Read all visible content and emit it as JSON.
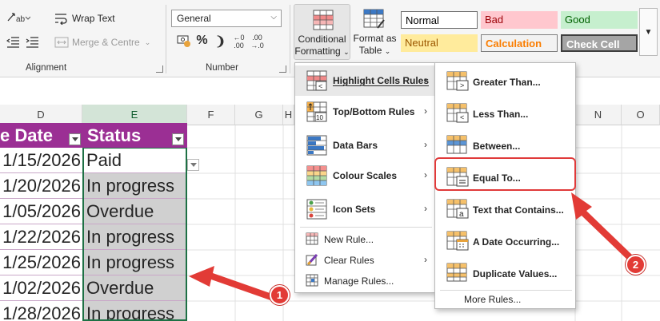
{
  "ribbon": {
    "alignment": {
      "wrap_text": "Wrap Text",
      "merge_centre": "Merge & Centre",
      "group_label": "Alignment"
    },
    "number": {
      "format_value": "General",
      "group_label": "Number",
      "icons": [
        "accounting-format-icon",
        "percent-icon",
        "comma-style-icon",
        "increase-decimal-icon",
        "decrease-decimal-icon"
      ]
    },
    "conditional_formatting": {
      "line1": "Conditional",
      "line2": "Formatting"
    },
    "format_as_table": {
      "line1": "Format as",
      "line2": "Table"
    },
    "cell_styles": [
      {
        "label": "Normal",
        "bg": "#ffffff",
        "fg": "#000000"
      },
      {
        "label": "Bad",
        "bg": "#ffc7ce",
        "fg": "#9c0006"
      },
      {
        "label": "Good",
        "bg": "#c6efce",
        "fg": "#006100"
      },
      {
        "label": "Neutral",
        "bg": "#ffeb9c",
        "fg": "#9c5700"
      },
      {
        "label": "Calculation",
        "bg": "#f2f2f2",
        "fg": "#fa7d00"
      },
      {
        "label": "Check Cell",
        "bg": "#a5a5a5",
        "fg": "#ffffff"
      }
    ]
  },
  "sheet": {
    "columns": [
      "D",
      "E",
      "F",
      "G",
      "H",
      "N",
      "O"
    ],
    "table_headers": {
      "due_date": "e Date",
      "status": "Status"
    },
    "rows": [
      {
        "date": "1/15/2026",
        "status": "Paid"
      },
      {
        "date": "1/20/2026",
        "status": "In progress"
      },
      {
        "date": "1/05/2026",
        "status": "Overdue"
      },
      {
        "date": "1/22/2026",
        "status": "In progress"
      },
      {
        "date": "1/25/2026",
        "status": "In progress"
      },
      {
        "date": "1/02/2026",
        "status": "Overdue"
      },
      {
        "date": "1/28/2026",
        "status": "In progress"
      }
    ]
  },
  "cf_menu": {
    "items": [
      {
        "label": "Highlight Cells Rules",
        "icon": "highlight-cells-icon"
      },
      {
        "label": "Top/Bottom Rules",
        "icon": "top-bottom-icon"
      },
      {
        "label": "Data Bars",
        "icon": "data-bars-icon"
      },
      {
        "label": "Colour Scales",
        "icon": "colour-scales-icon"
      },
      {
        "label": "Icon Sets",
        "icon": "icon-sets-icon"
      }
    ],
    "small_items": [
      {
        "label": "New Rule...",
        "icon": "new-rule-icon"
      },
      {
        "label": "Clear Rules",
        "icon": "clear-rules-icon"
      },
      {
        "label": "Manage Rules...",
        "icon": "manage-rules-icon"
      }
    ]
  },
  "hcr_menu": {
    "items": [
      {
        "label": "Greater Than...",
        "icon": "greater-than-icon"
      },
      {
        "label": "Less Than...",
        "icon": "less-than-icon"
      },
      {
        "label": "Between...",
        "icon": "between-icon"
      },
      {
        "label": "Equal To...",
        "icon": "equal-to-icon"
      },
      {
        "label": "Text that Contains...",
        "icon": "text-contains-icon"
      },
      {
        "label": "A Date Occurring...",
        "icon": "date-occurring-icon"
      },
      {
        "label": "Duplicate Values...",
        "icon": "duplicate-values-icon"
      }
    ],
    "more_rules": "More Rules..."
  },
  "annotations": {
    "badge1": "1",
    "badge2": "2",
    "color": "#e23b36"
  }
}
